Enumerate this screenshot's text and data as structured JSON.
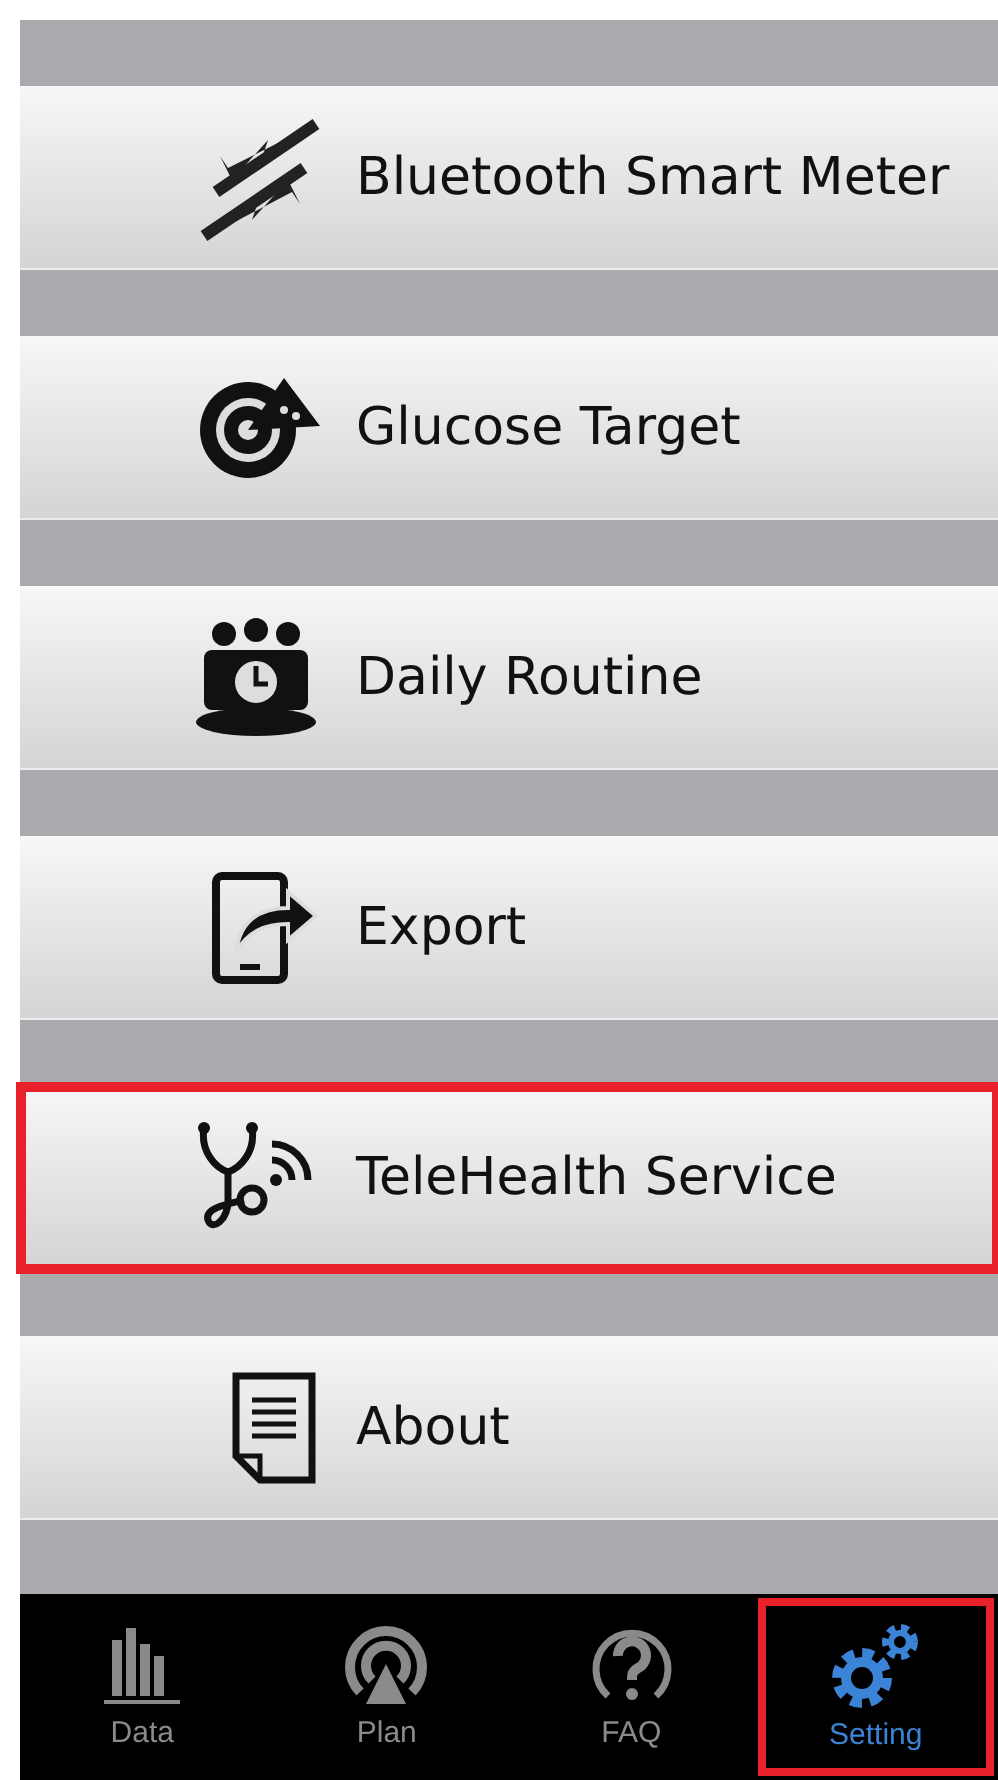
{
  "menu": [
    {
      "label": "Bluetooth Smart Meter",
      "highlighted": false
    },
    {
      "label": "Glucose Target",
      "highlighted": false
    },
    {
      "label": "Daily Routine",
      "highlighted": false
    },
    {
      "label": "Export",
      "highlighted": false
    },
    {
      "label": "TeleHealth Service",
      "highlighted": true
    },
    {
      "label": "About",
      "highlighted": false
    }
  ],
  "tabs": [
    {
      "label": "Data",
      "selected": false,
      "highlighted": false
    },
    {
      "label": "Plan",
      "selected": false,
      "highlighted": false
    },
    {
      "label": "FAQ",
      "selected": false,
      "highlighted": false
    },
    {
      "label": "Setting",
      "selected": true,
      "highlighted": true
    }
  ]
}
